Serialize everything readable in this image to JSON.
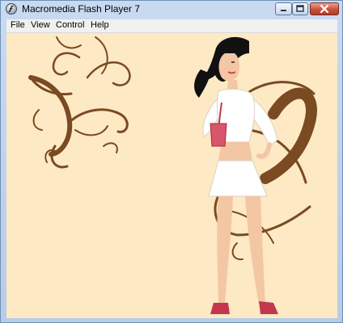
{
  "window": {
    "title": "Macromedia Flash Player 7",
    "icon": "flash-player-icon",
    "controls": [
      "minimize-icon",
      "maximize-icon",
      "close-icon"
    ]
  },
  "menu": {
    "items": [
      {
        "label": "File"
      },
      {
        "label": "View"
      },
      {
        "label": "Control"
      },
      {
        "label": "Help"
      }
    ]
  },
  "stage": {
    "background": "#fde9c3",
    "swirl_color": "#7a4a22",
    "content": "fashion-woman-illustration"
  }
}
